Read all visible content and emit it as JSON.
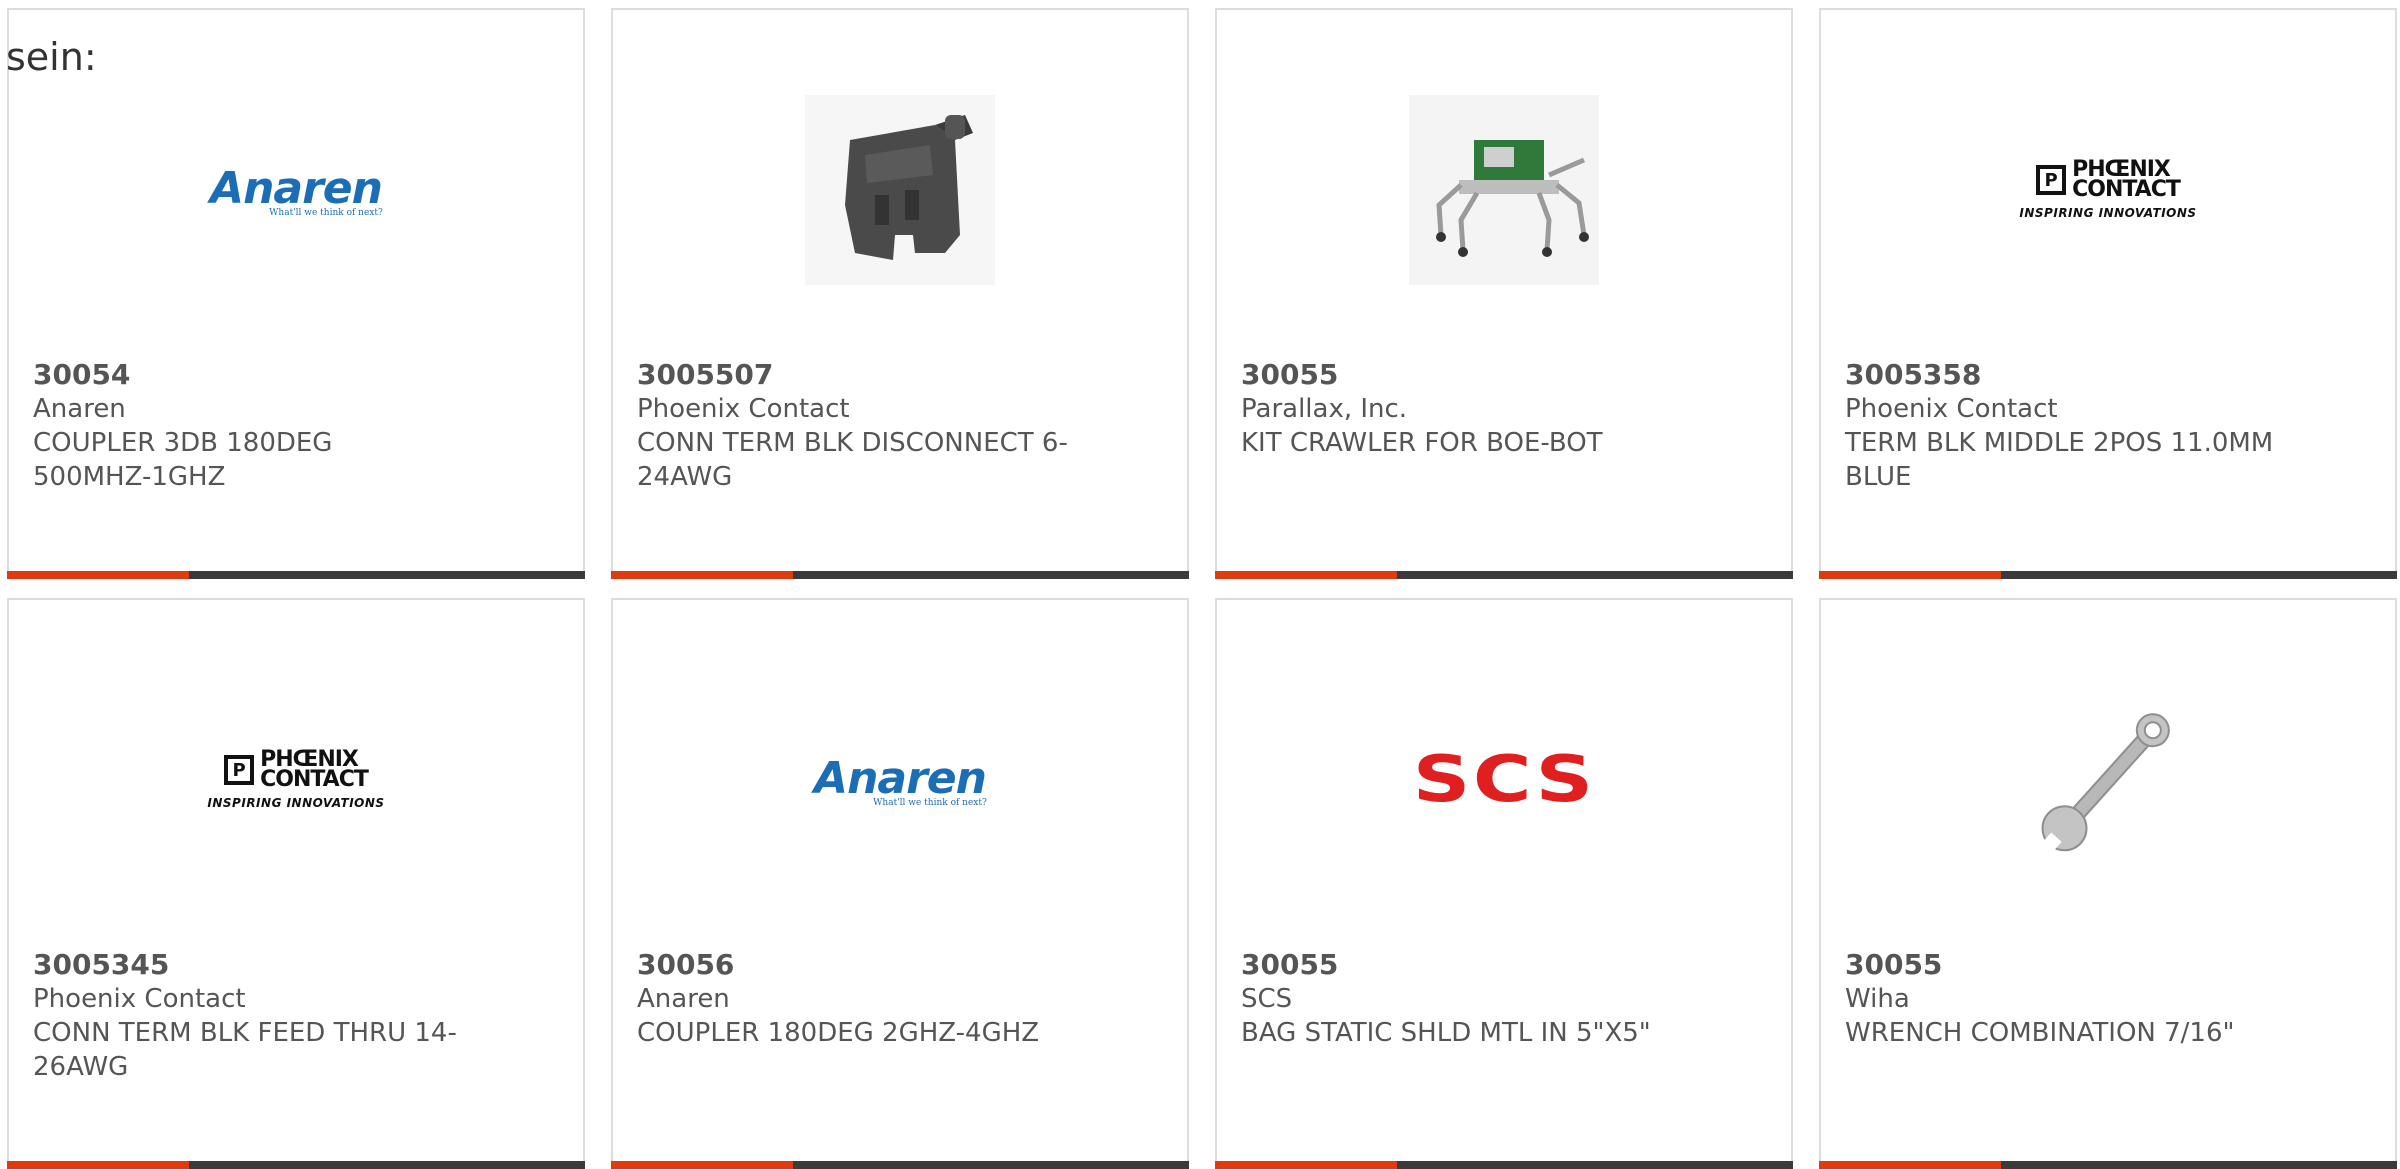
{
  "intro_text": "sein:",
  "colors": {
    "accent": "#e03b0e",
    "bar_dark": "#3a3a3a",
    "card_border": "#dcdcdc",
    "text": "#555555",
    "anaren_blue": "#1b6db5",
    "scs_red": "#e02020"
  },
  "products": [
    {
      "part_number": "30054",
      "manufacturer": "Anaren",
      "description": "COUPLER 3DB 180DEG 500MHZ-1GHZ",
      "image": "anaren-logo"
    },
    {
      "part_number": "3005507",
      "manufacturer": "Phoenix Contact",
      "description": "CONN TERM BLK DISCONNECT 6-24AWG",
      "image": "terminal-block-photo"
    },
    {
      "part_number": "30055",
      "manufacturer": "Parallax, Inc.",
      "description": "KIT CRAWLER FOR BOE-BOT",
      "image": "crawler-robot-photo"
    },
    {
      "part_number": "3005358",
      "manufacturer": "Phoenix Contact",
      "description": "TERM BLK MIDDLE 2POS 11.0MM BLUE",
      "image": "phoenix-contact-logo"
    },
    {
      "part_number": "3005345",
      "manufacturer": "Phoenix Contact",
      "description": "CONN TERM BLK FEED THRU 14-26AWG",
      "image": "phoenix-contact-logo"
    },
    {
      "part_number": "30056",
      "manufacturer": "Anaren",
      "description": "COUPLER 180DEG 2GHZ-4GHZ",
      "image": "anaren-logo"
    },
    {
      "part_number": "30055",
      "manufacturer": "SCS",
      "description": "BAG STATIC SHLD MTL IN 5\"X5\"",
      "image": "scs-logo"
    },
    {
      "part_number": "30055",
      "manufacturer": "Wiha",
      "description": "WRENCH COMBINATION 7/16\"",
      "image": "wrench-photo"
    }
  ],
  "logos": {
    "anaren_word": "Anaren",
    "anaren_tagline": "What'll we think of next?",
    "phoenix_line1": "PHŒNIX",
    "phoenix_line2": "CONTACT",
    "phoenix_sub": "INSPIRING INNOVATIONS",
    "scs_word": "SCS"
  }
}
